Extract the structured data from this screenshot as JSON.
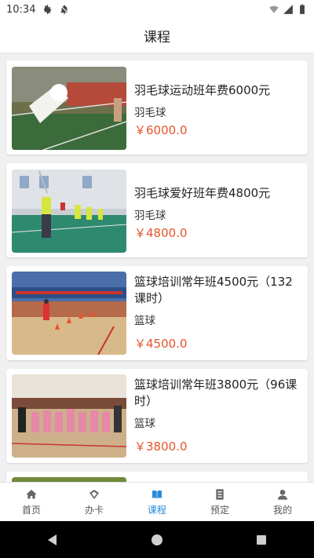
{
  "status_bar": {
    "time": "10:34",
    "icons": [
      "gear-icon",
      "notification-off-icon",
      "wifi-icon",
      "signal-icon",
      "battery-icon"
    ]
  },
  "header": {
    "title": "课程"
  },
  "courses": [
    {
      "title": "羽毛球运动班年费6000元",
      "category": "羽毛球",
      "price": "￥6000.0",
      "image": "badminton-shuttlecock-photo"
    },
    {
      "title": "羽毛球爱好班年费4800元",
      "category": "羽毛球",
      "price": "￥4800.0",
      "image": "badminton-class-photo"
    },
    {
      "title": "篮球培训常年班4500元（132课时）",
      "category": "篮球",
      "price": "￥4500.0",
      "image": "basketball-training-photo"
    },
    {
      "title": "篮球培训常年班3800元（96课时）",
      "category": "篮球",
      "price": "￥3800.0",
      "image": "basketball-kids-photo"
    }
  ],
  "tabs": [
    {
      "label": "首页",
      "icon": "home-icon",
      "active": false
    },
    {
      "label": "办卡",
      "icon": "card-icon",
      "active": false
    },
    {
      "label": "课程",
      "icon": "book-icon",
      "active": true
    },
    {
      "label": "预定",
      "icon": "list-icon",
      "active": false
    },
    {
      "label": "我的",
      "icon": "user-icon",
      "active": false
    }
  ],
  "colors": {
    "price": "#e8542a",
    "active_tab": "#2a8bd9"
  },
  "nav_bar": {
    "buttons": [
      "back-icon",
      "home-circle-icon",
      "recents-icon"
    ]
  }
}
